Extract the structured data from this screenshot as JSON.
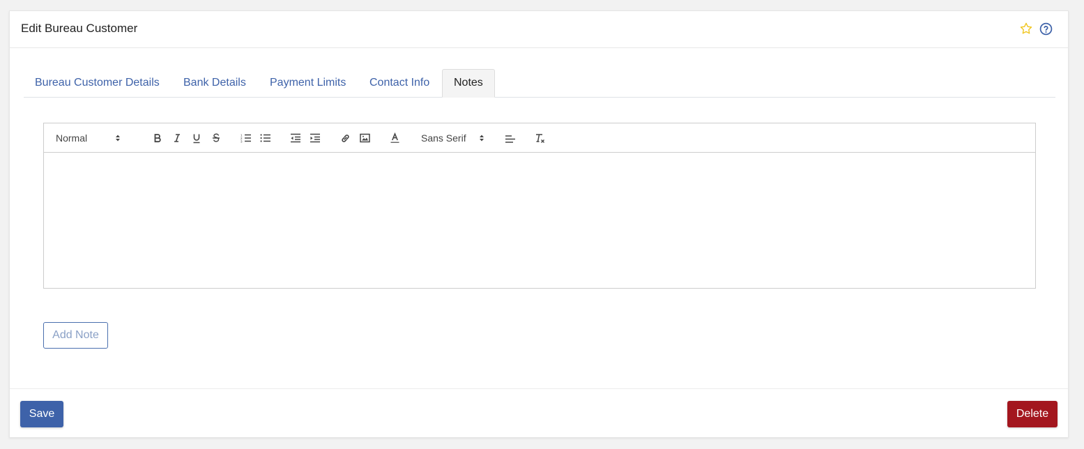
{
  "header": {
    "title": "Edit Bureau Customer",
    "favourite_icon": "star-outline-icon",
    "help_icon": "question-circle-icon",
    "colors": {
      "star": "#f0c419",
      "help": "#3e62a9"
    }
  },
  "tabs": [
    {
      "label": "Bureau Customer Details",
      "active": false
    },
    {
      "label": "Bank Details",
      "active": false
    },
    {
      "label": "Payment Limits",
      "active": false
    },
    {
      "label": "Contact Info",
      "active": false
    },
    {
      "label": "Notes",
      "active": true
    }
  ],
  "editor": {
    "heading_select": "Normal",
    "font_select": "Sans Serif",
    "content": "",
    "toolbar_icons": [
      "bold-icon",
      "italic-icon",
      "underline-icon",
      "strike-icon",
      "ordered-list-icon",
      "bullet-list-icon",
      "outdent-icon",
      "indent-icon",
      "link-icon",
      "image-icon",
      "text-color-icon",
      "align-icon",
      "clear-format-icon"
    ]
  },
  "actions": {
    "add_note": "Add Note",
    "save": "Save",
    "delete": "Delete"
  },
  "colors": {
    "primary": "#3e62a9",
    "danger": "#a3161e"
  }
}
